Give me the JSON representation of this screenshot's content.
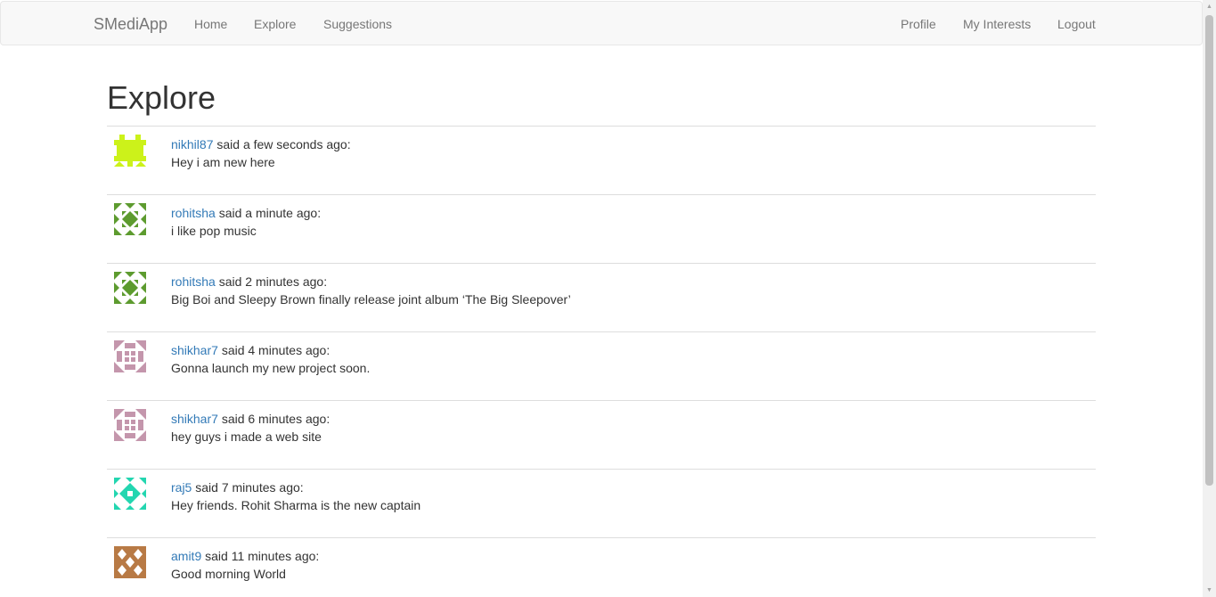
{
  "navbar": {
    "brand": "SMediApp",
    "left_links": [
      {
        "label": "Home",
        "name": "nav-home"
      },
      {
        "label": "Explore",
        "name": "nav-explore"
      },
      {
        "label": "Suggestions",
        "name": "nav-suggestions"
      }
    ],
    "right_links": [
      {
        "label": "Profile",
        "name": "nav-profile"
      },
      {
        "label": "My Interests",
        "name": "nav-my-interests"
      },
      {
        "label": "Logout",
        "name": "nav-logout"
      }
    ]
  },
  "page": {
    "title": "Explore"
  },
  "posts": [
    {
      "user": "nikhil87",
      "time": "said a few seconds ago:",
      "text": "Hey i am new here",
      "avatar_color": "#ccf21a",
      "avatar_pattern": "a"
    },
    {
      "user": "rohitsha",
      "time": "said a minute ago:",
      "text": "i like pop music",
      "avatar_color": "#5d9b2f",
      "avatar_pattern": "b"
    },
    {
      "user": "rohitsha",
      "time": "said 2 minutes ago:",
      "text": "Big Boi and Sleepy Brown finally release joint album ‘The Big Sleepover’",
      "avatar_color": "#5d9b2f",
      "avatar_pattern": "b"
    },
    {
      "user": "shikhar7",
      "time": "said 4 minutes ago:",
      "text": "Gonna launch my new project soon.",
      "avatar_color": "#c496ac",
      "avatar_pattern": "c"
    },
    {
      "user": "shikhar7",
      "time": "said 6 minutes ago:",
      "text": "hey guys i made a web site",
      "avatar_color": "#c496ac",
      "avatar_pattern": "c"
    },
    {
      "user": "raj5",
      "time": "said 7 minutes ago:",
      "text": "Hey friends. Rohit Sharma is the new captain",
      "avatar_color": "#23d6b0",
      "avatar_pattern": "d"
    },
    {
      "user": "amit9",
      "time": "said 11 minutes ago:",
      "text": "Good morning World",
      "avatar_color": "#b87a45",
      "avatar_pattern": "e"
    }
  ],
  "colors": {
    "link": "#337ab7",
    "navbar_bg": "#f8f8f8",
    "nav_text": "#777777"
  }
}
